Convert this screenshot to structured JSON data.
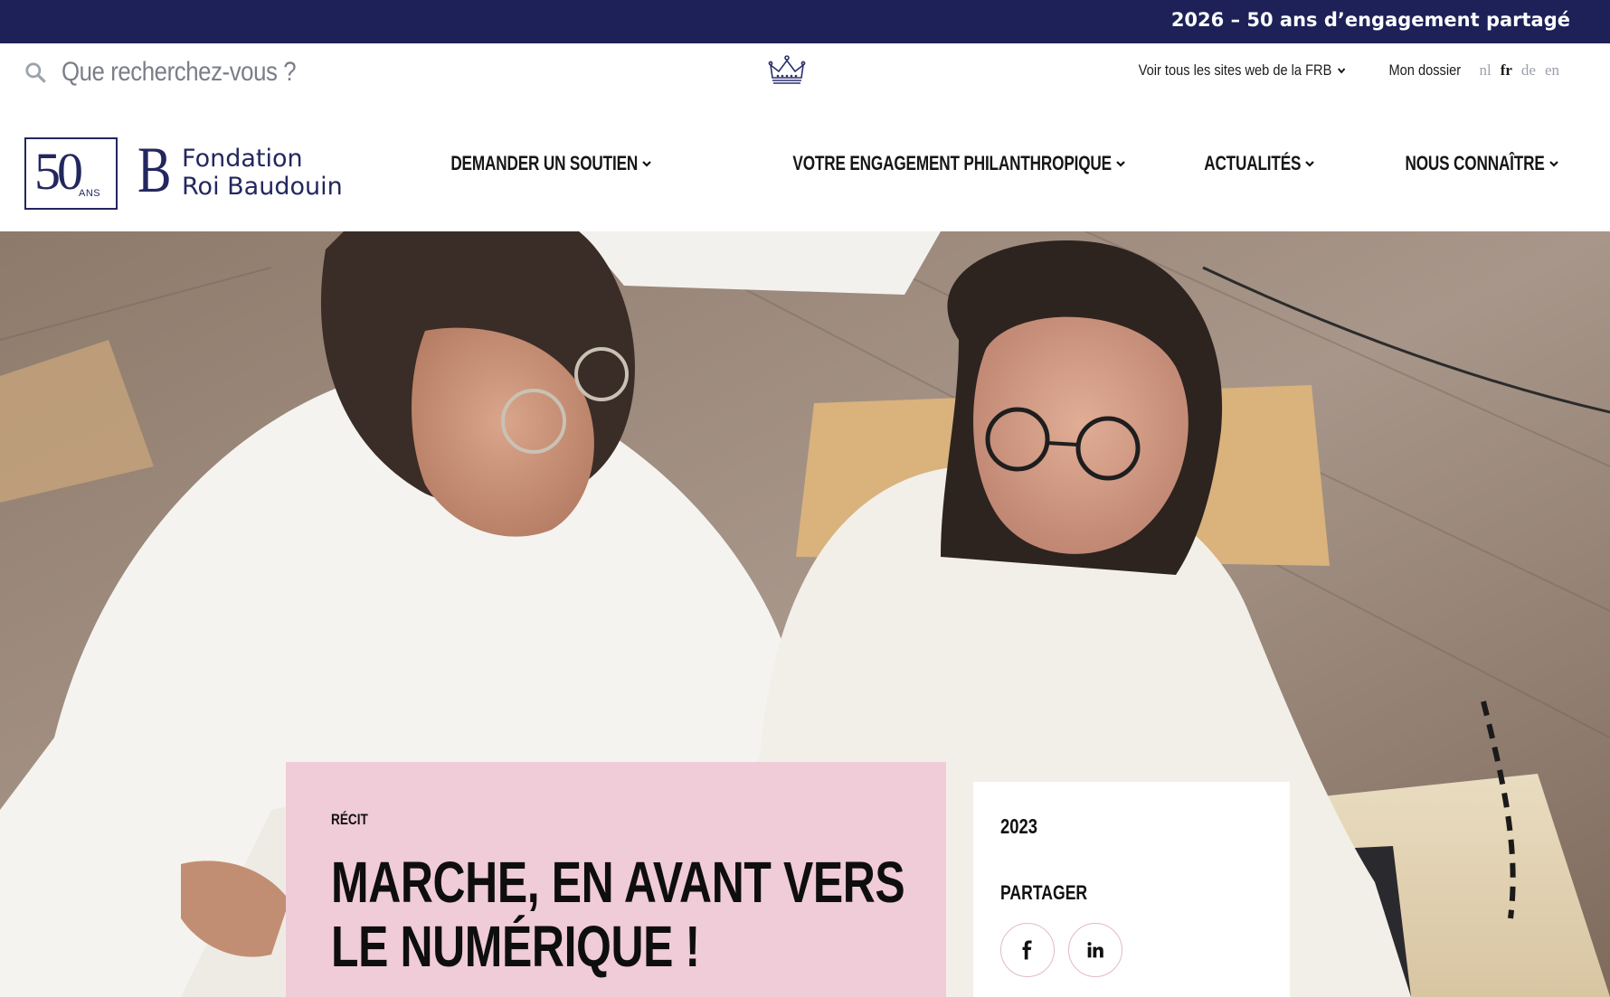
{
  "announcement": {
    "text": "2026 – 50 ans d’engagement partagé"
  },
  "search": {
    "placeholder": "Que recherchez-vous ?"
  },
  "utility": {
    "sites_label": "Voir tous les sites web de la FRB",
    "dossier_label": "Mon dossier",
    "languages": [
      {
        "code": "nl",
        "active": false
      },
      {
        "code": "fr",
        "active": true
      },
      {
        "code": "de",
        "active": false
      },
      {
        "code": "en",
        "active": false
      }
    ]
  },
  "logo": {
    "anniversary_number": "50",
    "anniversary_word": "ANS",
    "monogram": "B",
    "line1": "Fondation",
    "line2": "Roi Baudouin"
  },
  "nav": {
    "items": [
      {
        "label": "DEMANDER UN SOUTIEN"
      },
      {
        "label": "VOTRE ENGAGEMENT PHILANTHROPIQUE"
      },
      {
        "label": "ACTUALITÉS"
      },
      {
        "label": "NOUS CONNAÎTRE"
      }
    ]
  },
  "article": {
    "kicker": "RÉCIT",
    "title": "MARCHE, EN AVANT VERS LE NUMÉRIQUE !"
  },
  "meta": {
    "year": "2023",
    "share_label": "PARTAGER"
  },
  "icons": {
    "search": "search-icon",
    "crown": "crown-icon",
    "chevron": "chevron-down-icon",
    "facebook": "facebook-icon",
    "linkedin": "linkedin-icon"
  },
  "colors": {
    "brand_navy": "#1d2157",
    "card_pink": "#f0cbd8",
    "text_dark": "#111111"
  }
}
